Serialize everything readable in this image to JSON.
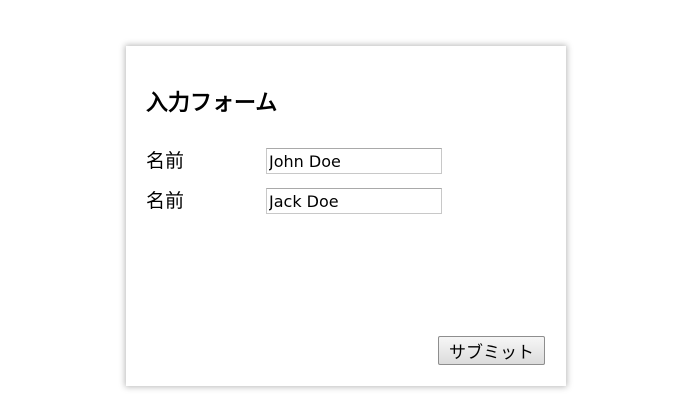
{
  "form": {
    "title": "入力フォーム",
    "fields": [
      {
        "label": "名前",
        "value": "John Doe"
      },
      {
        "label": "名前",
        "value": "Jack Doe"
      }
    ],
    "submit_label": "サブミット"
  }
}
